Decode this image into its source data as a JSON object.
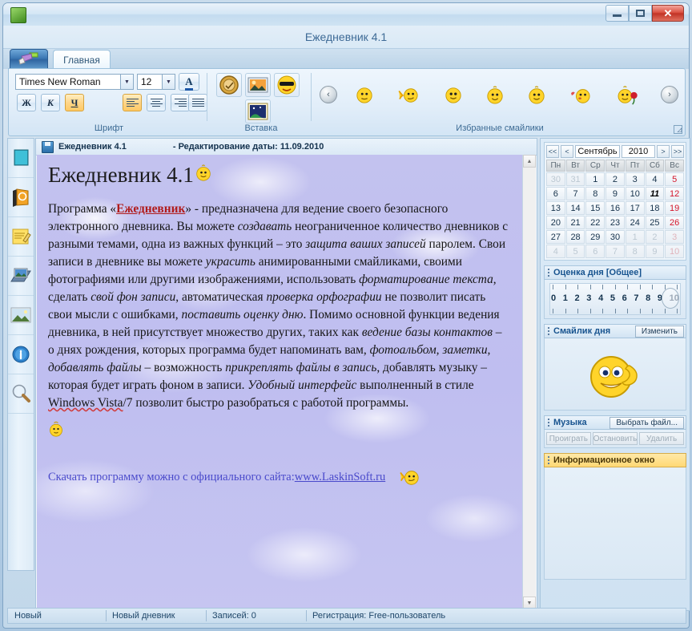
{
  "window": {
    "title": "Ежедневник 4.1",
    "minimize_label": "Свернуть",
    "maximize_label": "Развернуть",
    "close_label": "✕"
  },
  "ribbon": {
    "app_button_name": "app-menu",
    "tabs": [
      {
        "label": "Главная"
      }
    ],
    "groups": {
      "font": {
        "label": "Шрифт",
        "font_name": "Times New Roman",
        "font_size": "12",
        "color_label": "A",
        "bold_label": "Ж",
        "italic_label": "К",
        "underline_label": "Ч",
        "align_left": "",
        "align_center": "",
        "align_right": "",
        "align_justify": ""
      },
      "insert": {
        "label": "Вставка",
        "items": [
          "seal-icon",
          "photo-icon",
          "smiley-icon",
          "background-icon"
        ]
      },
      "smileys": {
        "label": "Избранные смайлики",
        "prev": "‹",
        "next": "›",
        "items": [
          "smiley-plain",
          "smiley-wave",
          "smiley-happy",
          "smiley-grin",
          "smiley-smile",
          "smiley-kiss",
          "smiley-rose"
        ]
      }
    }
  },
  "leftbar": {
    "items": [
      {
        "name": "diary-icon"
      },
      {
        "name": "contacts-book-icon"
      },
      {
        "name": "notes-icon"
      },
      {
        "name": "photoalbum-icon"
      },
      {
        "name": "gallery-icon"
      },
      {
        "name": "info-icon"
      },
      {
        "name": "search-icon"
      }
    ]
  },
  "document": {
    "header_title": "Ежедневник 4.1",
    "header_date": "- Редактирование даты: 11.09.2010",
    "title": "Ежедневник 4.1",
    "link_prefix": "Скачать программу можно с официального сайта: ",
    "link_text": "www.LaskinSoft.ru"
  },
  "rightpanel": {
    "calendar": {
      "first_prev": "<<",
      "prev": "<",
      "month": "Сентябрь",
      "year": "2010",
      "next": ">",
      "last_next": ">>",
      "dow": [
        "Пн",
        "Вт",
        "Ср",
        "Чт",
        "Пт",
        "Сб",
        "Вс"
      ],
      "weeks": [
        [
          {
            "d": "30",
            "out": true
          },
          {
            "d": "31",
            "out": true
          },
          {
            "d": "1"
          },
          {
            "d": "2"
          },
          {
            "d": "3"
          },
          {
            "d": "4"
          },
          {
            "d": "5",
            "we": true
          }
        ],
        [
          {
            "d": "6"
          },
          {
            "d": "7"
          },
          {
            "d": "8"
          },
          {
            "d": "9"
          },
          {
            "d": "10"
          },
          {
            "d": "11",
            "sel": true
          },
          {
            "d": "12",
            "we": true
          }
        ],
        [
          {
            "d": "13"
          },
          {
            "d": "14"
          },
          {
            "d": "15"
          },
          {
            "d": "16"
          },
          {
            "d": "17"
          },
          {
            "d": "18"
          },
          {
            "d": "19",
            "we": true
          }
        ],
        [
          {
            "d": "20"
          },
          {
            "d": "21"
          },
          {
            "d": "22"
          },
          {
            "d": "23"
          },
          {
            "d": "24"
          },
          {
            "d": "25"
          },
          {
            "d": "26",
            "we": true
          }
        ],
        [
          {
            "d": "27"
          },
          {
            "d": "28"
          },
          {
            "d": "29"
          },
          {
            "d": "30"
          },
          {
            "d": "1",
            "out": true
          },
          {
            "d": "2",
            "out": true
          },
          {
            "d": "3",
            "out": true,
            "we": true
          }
        ],
        [
          {
            "d": "4",
            "out": true
          },
          {
            "d": "5",
            "out": true
          },
          {
            "d": "6",
            "out": true
          },
          {
            "d": "7",
            "out": true
          },
          {
            "d": "8",
            "out": true
          },
          {
            "d": "9",
            "out": true
          },
          {
            "d": "10",
            "out": true,
            "we": true
          }
        ]
      ]
    },
    "rating": {
      "title": "Оценка дня [Общее]",
      "values": [
        "0",
        "1",
        "2",
        "3",
        "4",
        "5",
        "6",
        "7",
        "8",
        "9",
        "10"
      ],
      "selected": "10"
    },
    "smiley": {
      "title": "Смайлик дня",
      "change_label": "Изменить"
    },
    "music": {
      "title": "Музыка",
      "choose_label": "Выбрать файл...",
      "play_label": "Проиграть",
      "stop_label": "Остановить",
      "delete_label": "Удалить"
    },
    "info": {
      "title": "Информационное окно"
    }
  },
  "statusbar": {
    "item1": "Новый",
    "item2": "Новый дневник",
    "item3": "Записей: 0",
    "item4": "Регистрация: Free-пользователь"
  },
  "colors": {
    "accent": "#17538f",
    "highlight": "#ffd974",
    "link": "#4a4acb",
    "weekend": "#d4162b",
    "close": "#c23325"
  }
}
